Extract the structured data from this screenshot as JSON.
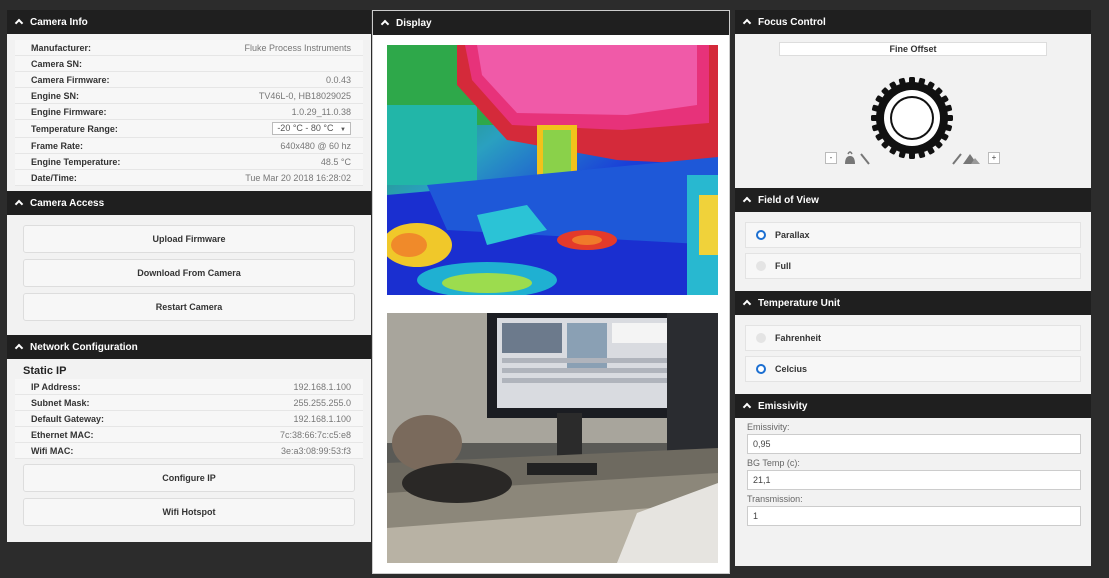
{
  "camera_info": {
    "title": "Camera Info",
    "rows": [
      {
        "label": "Manufacturer:",
        "value": "Fluke Process Instruments"
      },
      {
        "label": "Camera SN:",
        "value": ""
      },
      {
        "label": "Camera Firmware:",
        "value": "0.0.43"
      },
      {
        "label": "Engine SN:",
        "value": "TV46L-0, HB18029025"
      },
      {
        "label": "Engine Firmware:",
        "value": "1.0.29_11.0.38"
      },
      {
        "label": "Temperature Range:",
        "value": "-20 °C - 80 °C"
      },
      {
        "label": "Frame Rate:",
        "value": "640x480 @ 60 hz"
      },
      {
        "label": "Engine Temperature:",
        "value": "48.5 °C"
      },
      {
        "label": "Date/Time:",
        "value": "Tue Mar 20 2018 16:28:02"
      }
    ]
  },
  "camera_access": {
    "title": "Camera Access",
    "upload": "Upload Firmware",
    "download": "Download From Camera",
    "restart": "Restart Camera"
  },
  "network": {
    "title": "Network Configuration",
    "subtitle": "Static IP",
    "rows": [
      {
        "label": "IP Address:",
        "value": "192.168.1.100"
      },
      {
        "label": "Subnet Mask:",
        "value": "255.255.255.0"
      },
      {
        "label": "Default Gateway:",
        "value": "192.168.1.100"
      },
      {
        "label": "Ethernet MAC:",
        "value": "7c:38:66:7c:c5:e8"
      },
      {
        "label": "Wifi MAC:",
        "value": "3e:a3:08:99:53:f3"
      }
    ],
    "configure": "Configure IP",
    "hotspot": "Wifi Hotspot"
  },
  "display": {
    "title": "Display"
  },
  "focus": {
    "title": "Focus Control",
    "mode": "Fine Offset",
    "minus": "-",
    "plus": "+"
  },
  "fov": {
    "title": "Field of View",
    "options": [
      {
        "label": "Parallax",
        "selected": true
      },
      {
        "label": "Full",
        "selected": false
      }
    ]
  },
  "temp_unit": {
    "title": "Temperature Unit",
    "options": [
      {
        "label": "Fahrenheit",
        "selected": false
      },
      {
        "label": "Celcius",
        "selected": true
      }
    ]
  },
  "emissivity": {
    "title": "Emissivity",
    "emissivity_label": "Emissivity:",
    "emissivity_value": "0,95",
    "bg_label": "BG Temp (c):",
    "bg_value": "21,1",
    "trans_label": "Transmission:",
    "trans_value": "1"
  },
  "colors": {
    "header": "#1f1f1f",
    "radio_accent": "#1c6fd1"
  }
}
